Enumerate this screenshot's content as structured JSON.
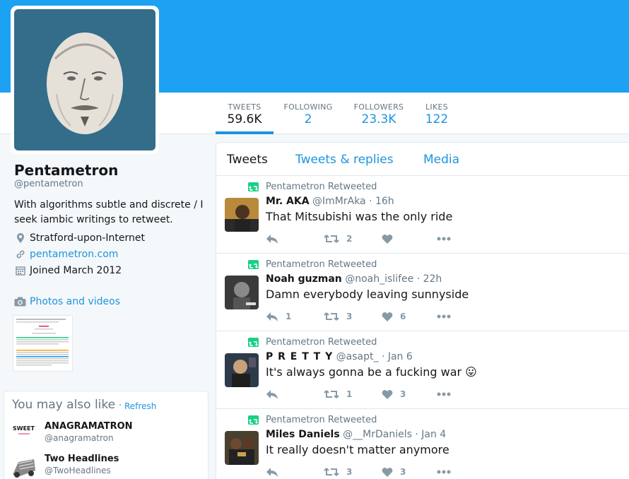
{
  "profile": {
    "name": "Pentametron",
    "handle": "@pentametron",
    "bio": "With algorithms subtle and discrete / I seek iambic writings to retweet.",
    "location": "Stratford-upon-Internet",
    "website": "pentametron.com",
    "joined": "Joined March 2012",
    "photos_label": "Photos and videos"
  },
  "stats": [
    {
      "label": "TWEETS",
      "value": "59.6K"
    },
    {
      "label": "FOLLOWING",
      "value": "2"
    },
    {
      "label": "FOLLOWERS",
      "value": "23.3K"
    },
    {
      "label": "LIKES",
      "value": "122"
    }
  ],
  "tabs": [
    "Tweets",
    "Tweets & replies",
    "Media"
  ],
  "who_to_follow": {
    "title": "You may also like",
    "separator": "·",
    "refresh": "Refresh",
    "users": [
      {
        "name": "ANAGRAMATRON",
        "handle": "@anagramatron",
        "icon": "sweet-tweets-logo",
        "icon_text": "SWEET TWEETS"
      },
      {
        "name": "Two Headlines",
        "handle": "@TwoHeadlines",
        "icon": "newspaper-press-icon"
      }
    ]
  },
  "tweets": [
    {
      "retweeted_by": "Pentametron Retweeted",
      "name": "Mr. AKA",
      "handle": "@ImMrAka",
      "time": "· 16h",
      "text": "That Mitsubishi was the only ride",
      "replies": "",
      "retweets": "2",
      "likes": ""
    },
    {
      "retweeted_by": "Pentametron Retweeted",
      "name": "Noah guzman",
      "handle": "@noah_islifee",
      "time": "· 22h",
      "text": "Damn everybody leaving sunnyside",
      "replies": "1",
      "retweets": "3",
      "likes": "6"
    },
    {
      "retweeted_by": "Pentametron Retweeted",
      "name": "P R E T T Y",
      "handle": "@asapt_",
      "time": "· Jan 6",
      "text": "It's always gonna be a fucking war",
      "emoji": "😛",
      "replies": "",
      "retweets": "1",
      "likes": "3"
    },
    {
      "retweeted_by": "Pentametron Retweeted",
      "name": "Miles Daniels",
      "handle": "@__MrDaniels",
      "time": "· Jan 4",
      "text": "It really doesn't matter anymore",
      "replies": "",
      "retweets": "3",
      "likes": "3"
    }
  ],
  "colors": {
    "banner": "#1da1f2",
    "link": "#1b95e0",
    "retweet_green": "#19cf86",
    "avatar_bg": "#336d8a"
  }
}
